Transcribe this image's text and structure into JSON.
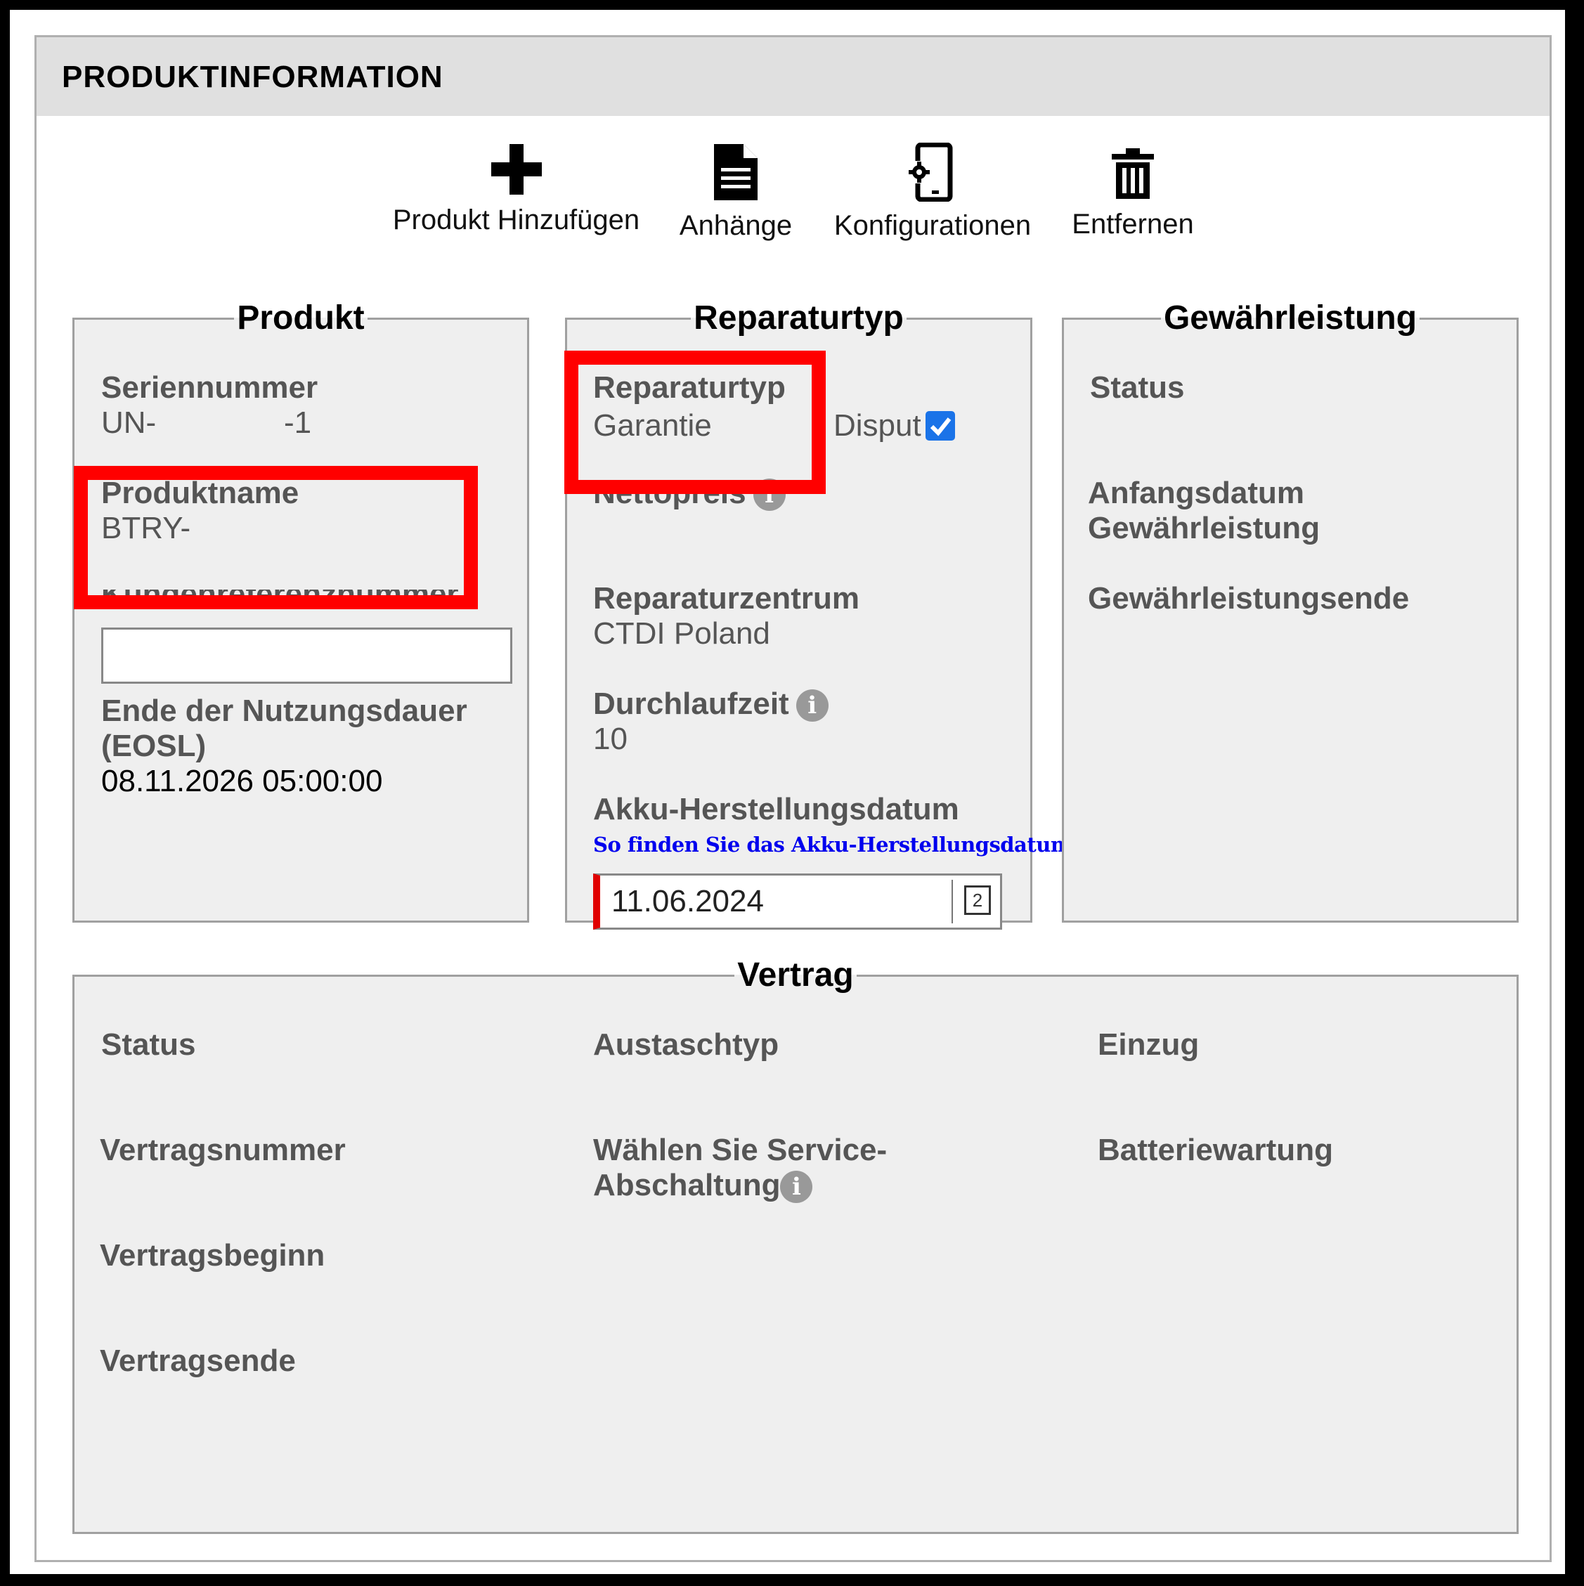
{
  "header": {
    "title": "PRODUKTINFORMATION"
  },
  "toolbar": {
    "add_label": "Produkt Hinzufügen",
    "attachments_label": "Anhänge",
    "config_label": "Konfigurationen",
    "remove_label": "Entfernen"
  },
  "produkt": {
    "legend": "Produkt",
    "serial_label": "Seriennummer",
    "serial_value_start": "UN-",
    "serial_value_end": "-1",
    "name_label": "Produktname",
    "name_value": "BTRY-",
    "ref_label": "Kundenreferenznummer",
    "ref_value": "",
    "eosl_label_line1": "Ende der Nutzungsdauer",
    "eosl_label_line2": "(EOSL)",
    "eosl_value": "08.11.2026 05:00:00"
  },
  "reparatur": {
    "legend": "Reparaturtyp",
    "type_label": "Reparaturtyp",
    "type_value": "Garantie",
    "disput_label": "Disput",
    "disput_checked": true,
    "netto_label": "Nettopreis",
    "center_label": "Reparaturzentrum",
    "center_value": "CTDI Poland",
    "lead_label": "Durchlaufzeit",
    "lead_value": "10",
    "akku_label": "Akku-Herstellungsdatum",
    "akku_link": "So finden Sie das Akku-Herstellungsdatum",
    "akku_value": "11.06.2024",
    "calendar_day": "2"
  },
  "gewaehr": {
    "legend": "Gewährleistung",
    "status_label": "Status",
    "start_label_line1": "Anfangsdatum",
    "start_label_line2": "Gewährleistung",
    "end_label": "Gewährleistungsende"
  },
  "vertrag": {
    "legend": "Vertrag",
    "status_label": "Status",
    "number_label": "Vertragsnummer",
    "begin_label": "Vertragsbeginn",
    "end_label": "Vertragsende",
    "exchange_label": "Austaschtyp",
    "service_label_line1": "Wählen Sie Service-",
    "service_label_line2": "Abschaltung",
    "collect_label": "Einzug",
    "battery_label": "Batteriewartung"
  },
  "colors": {
    "highlight": "#ff0000",
    "link": "#0000ee",
    "checkbox": "#1a73e8",
    "required": "#e00000"
  }
}
